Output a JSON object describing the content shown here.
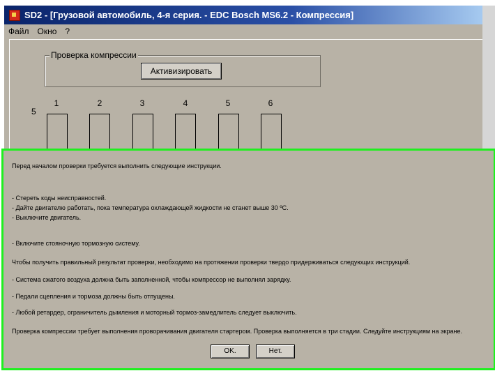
{
  "window": {
    "title": "SD2 - [Грузовой автомобиль, 4-я серия. - EDC Bosch MS6.2 - Компрессия]"
  },
  "menu": {
    "items": [
      "Файл",
      "Окно",
      "?"
    ]
  },
  "compression": {
    "group_label": "Проверка компрессии",
    "activate_label": "Активизировать",
    "side_number": "5",
    "cylinders": [
      "1",
      "2",
      "3",
      "4",
      "5",
      "6"
    ]
  },
  "dialog": {
    "lines": [
      "Перед началом проверки требуется выполнить следующие инструкции.",
      "- Стереть коды неисправностей.",
      "- Дайте двигателю работать, пока температура охлаждающей жидкости не станет выше 30 ºC.",
      "- Выключите двигатель.",
      "- Включите стояночную тормозную систему.",
      "Чтобы получить правильный результат проверки, необходимо на протяжении проверки твердо придерживаться следующих инструкций.",
      "- Система сжатого воздуха должна быть заполненной, чтобы компрессор не выполнял зарядку.",
      "- Педали сцепления и тормоза должны быть отпущены.",
      "- Любой ретардер, ограничитель дымления и моторный тормоз-замедлитель следует выключить.",
      "Проверка компрессии требует выполнения проворачивания двигателя стартером. Проверка выполняется в три стадии. Следуйте инструкциям на экране."
    ],
    "ok_label": "OK.",
    "no_label": "Нет."
  }
}
